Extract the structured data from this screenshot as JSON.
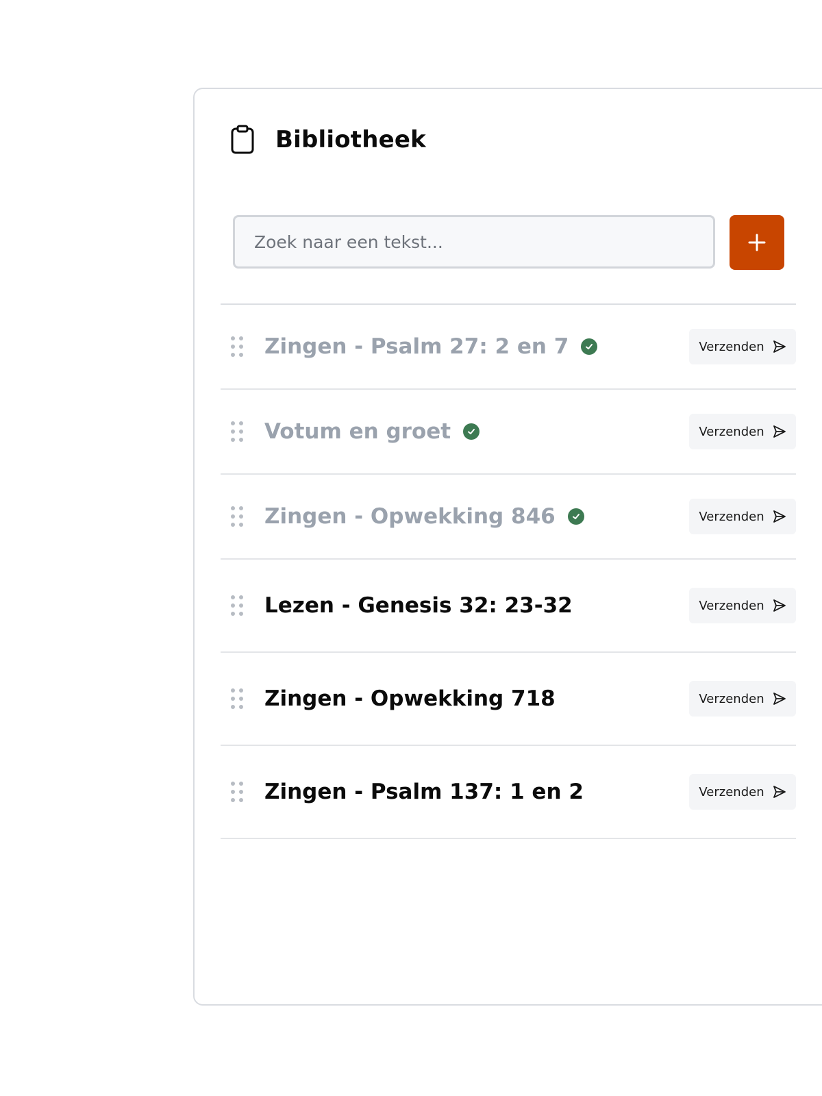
{
  "header": {
    "title": "Bibliotheek",
    "icon": "clipboard-icon"
  },
  "search": {
    "placeholder": "Zoek naar een tekst..."
  },
  "add_button": {
    "label": "+",
    "color": "#c84500"
  },
  "colors": {
    "done_text": "#9aa2ad",
    "pending_text": "#0b0b0b",
    "check_badge": "#3d7a52"
  },
  "items": [
    {
      "title": "Zingen - Psalm 27: 2 en 7",
      "sent": true,
      "action_label": "Verzenden"
    },
    {
      "title": "Votum en groet",
      "sent": true,
      "action_label": "Verzenden"
    },
    {
      "title": "Zingen - Opwekking 846",
      "sent": true,
      "action_label": "Verzenden"
    },
    {
      "title": "Lezen - Genesis 32: 23-32",
      "sent": false,
      "action_label": "Verzenden"
    },
    {
      "title": "Zingen - Opwekking 718",
      "sent": false,
      "action_label": "Verzenden"
    },
    {
      "title": "Zingen - Psalm 137: 1 en 2",
      "sent": false,
      "action_label": "Verzenden"
    }
  ]
}
